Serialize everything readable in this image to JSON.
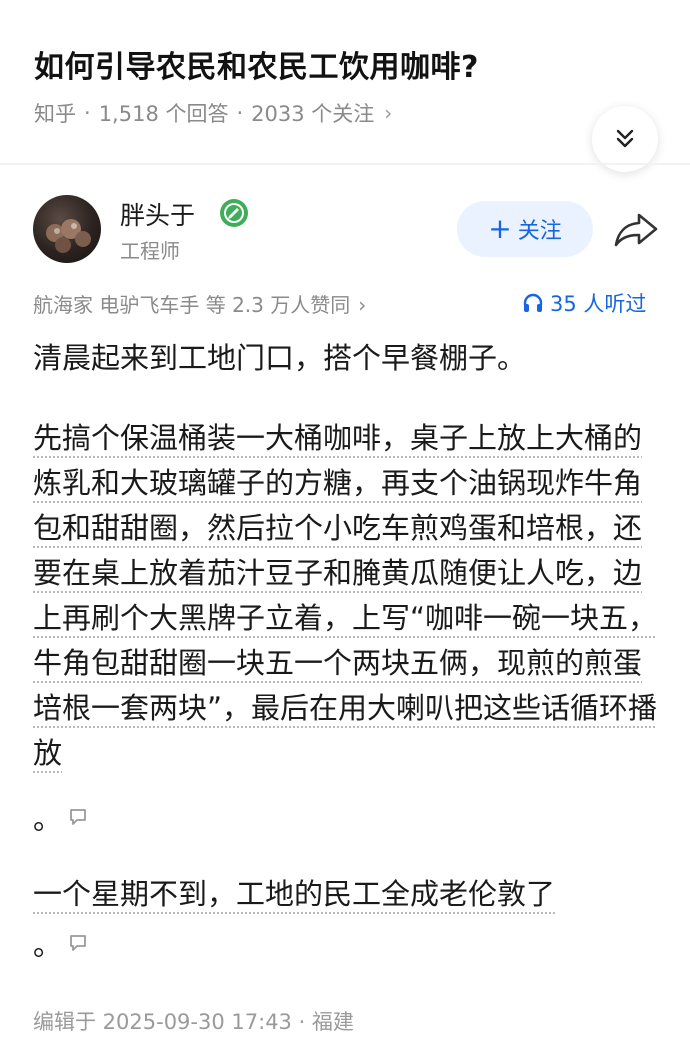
{
  "question": {
    "title": "如何引导农民和农民工饮用咖啡?",
    "source": "知乎",
    "answers": "1,518 个回答",
    "followers": "2033 个关注"
  },
  "author": {
    "name": "胖头于",
    "title": "工程师",
    "follow_label": "关注"
  },
  "upvote_text": "航海家 电驴飞车手 等 2.3 万人赞同",
  "listen_text": "35 人听过",
  "content": {
    "p1": "清晨起来到工地门口，搭个早餐棚子。",
    "p2": "先搞个保温桶装一大桶咖啡，桌子上放上大桶的炼乳和大玻璃罐子的方糖，再支个油锅现炸牛角包和甜甜圈，然后拉个小吃车煎鸡蛋和培根，还要在桌上放着茄汁豆子和腌黄瓜随便让人吃，边上再刷个大黑牌子立着，上写“咖啡一碗一块五，牛角包甜甜圈一块五一个两块五俩，现煎的煎蛋培根一套两块”，最后在用大喇叭把这些话循环播放",
    "p2_tail": "。",
    "p3": "一个星期不到，工地的民工全成老伦敦了",
    "p3_tail": "。"
  },
  "edit_info": "编辑于 2025-09-30 17:43 · 福建",
  "icons": {
    "collapse": "double-chevron-down-icon",
    "verified": "verified-badge-icon",
    "share": "share-arrow-icon",
    "listen": "headphones-icon",
    "comment": "comment-bubble-icon"
  },
  "colors": {
    "accent": "#1766e0",
    "follow_bg": "#eaf2ff",
    "verified_green": "#3fae5a",
    "muted": "#8a8a8a"
  }
}
